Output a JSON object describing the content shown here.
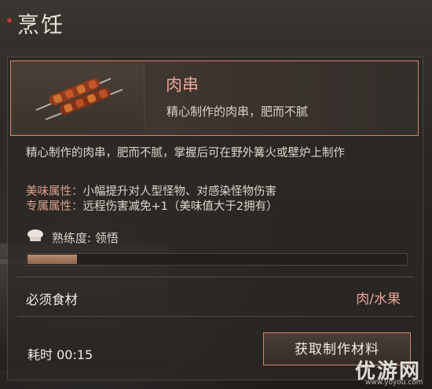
{
  "header": {
    "title": "烹饪"
  },
  "item": {
    "name": "肉串",
    "short_description": "精心制作的肉串，肥而不腻",
    "image_icon": "meat-skewer-icon"
  },
  "details": {
    "description": "精心制作的肉串，肥而不腻，掌握后可在野外篝火或壁炉上制作",
    "taste_label": "美味属性：",
    "taste_value": "小幅提升对人型怪物、对感染怪物伤害",
    "exclusive_label": "专属属性：",
    "exclusive_value": "远程伤害减免+1（美味值大于2拥有）"
  },
  "mastery": {
    "icon": "chef-hat-icon",
    "text": "熟练度: 领悟",
    "progress": 0.13
  },
  "ingredients": {
    "label": "必须食材",
    "value": "肉/水果"
  },
  "footer": {
    "time_label": "耗时 00:15",
    "action_button": "获取制作材料"
  },
  "watermark": {
    "text": "优游网",
    "sub": "www.yoyou.com"
  },
  "colors": {
    "accent": "#e8a79a",
    "border": "#c98a6e"
  }
}
